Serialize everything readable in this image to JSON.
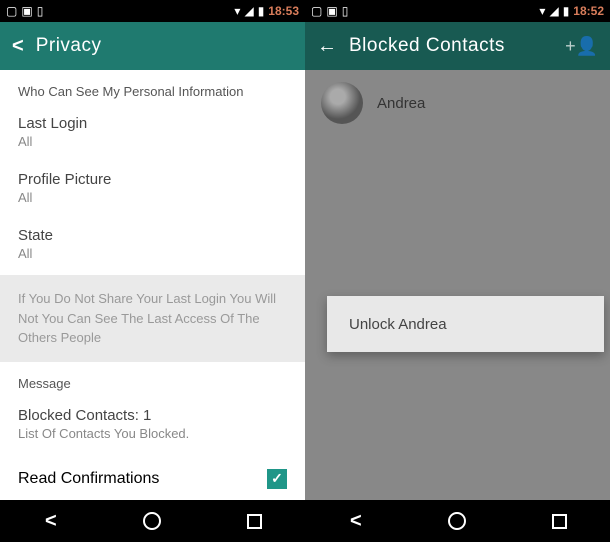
{
  "left": {
    "status": {
      "time": "18:53"
    },
    "appbar": {
      "title": "Privacy"
    },
    "section1": "Who Can See My Personal Information",
    "lastLogin": {
      "title": "Last Login",
      "value": "All"
    },
    "profilePic": {
      "title": "Profile Picture",
      "value": "All"
    },
    "state": {
      "title": "State",
      "value": "All"
    },
    "infoNote": "If You Do Not Share Your Last Login You Will Not\nYou Can See The Last Access Of The Others\nPeople",
    "section2": "Message",
    "blocked": {
      "title": "Blocked Contacts: 1",
      "subtitle": "List Of Contacts You Blocked."
    },
    "readConfirm": {
      "label": "Read Confirmations"
    }
  },
  "right": {
    "status": {
      "time": "18:52"
    },
    "appbar": {
      "title": "Blocked Contacts"
    },
    "contact": {
      "name": "Andrea"
    },
    "popup": {
      "label": "Unlock Andrea"
    }
  }
}
